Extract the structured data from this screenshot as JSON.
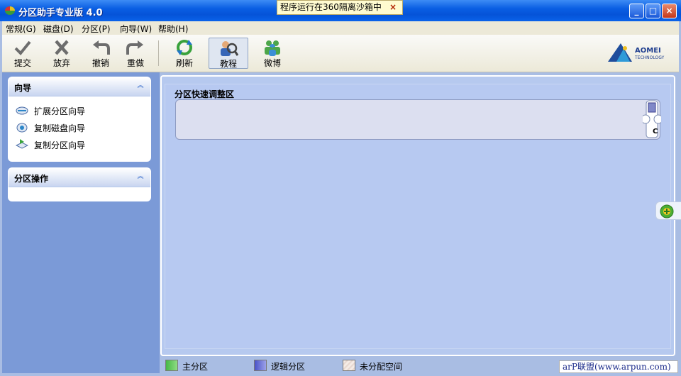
{
  "window": {
    "title": "分区助手专业版 4.0",
    "minimize_label": "_",
    "maximize_label": "□",
    "close_label": "×"
  },
  "sandbox_notice": {
    "text": "程序运行在360隔离沙箱中",
    "close_label": "×"
  },
  "menu": [
    {
      "label": "常规(G)"
    },
    {
      "label": "磁盘(D)"
    },
    {
      "label": "分区(P)"
    },
    {
      "label": "向导(W)"
    },
    {
      "label": "帮助(H)"
    }
  ],
  "toolbar": [
    {
      "label": "提交",
      "icon": "check-icon"
    },
    {
      "label": "放弃",
      "icon": "x-icon"
    },
    {
      "label": "撤销",
      "icon": "undo-icon"
    },
    {
      "label": "重做",
      "icon": "redo-icon"
    },
    {
      "label": "刷新",
      "icon": "refresh-icon"
    },
    {
      "label": "教程",
      "icon": "tutorial-icon"
    },
    {
      "label": "微博",
      "icon": "weibo-icon"
    }
  ],
  "logo": {
    "name": "AOMEI",
    "sub": "TECHNOLOGY"
  },
  "sidebar": {
    "wizard_group": {
      "title": "向导",
      "items": [
        {
          "label": "扩展分区向导",
          "icon": "extend-partition-icon"
        },
        {
          "label": "复制磁盘向导",
          "icon": "copy-disk-icon"
        },
        {
          "label": "复制分区向导",
          "icon": "copy-partition-icon"
        }
      ]
    },
    "operations_group": {
      "title": "分区操作"
    }
  },
  "main": {
    "region_title": "分区快速调整区",
    "handle_label": "C"
  },
  "legend": [
    {
      "label": "主分区",
      "color": "#46b845"
    },
    {
      "label": "逻辑分区",
      "color": "#4a52c8"
    },
    {
      "label": "未分配空间",
      "color": "#f1e6e0"
    }
  ],
  "watermark": {
    "text": "arP联盟(www.arpun.com)"
  },
  "colors": {
    "titlebar": "#0a5ee3",
    "pane_bg": "#7b9ad7",
    "main_bg": "#b7c9f1"
  }
}
